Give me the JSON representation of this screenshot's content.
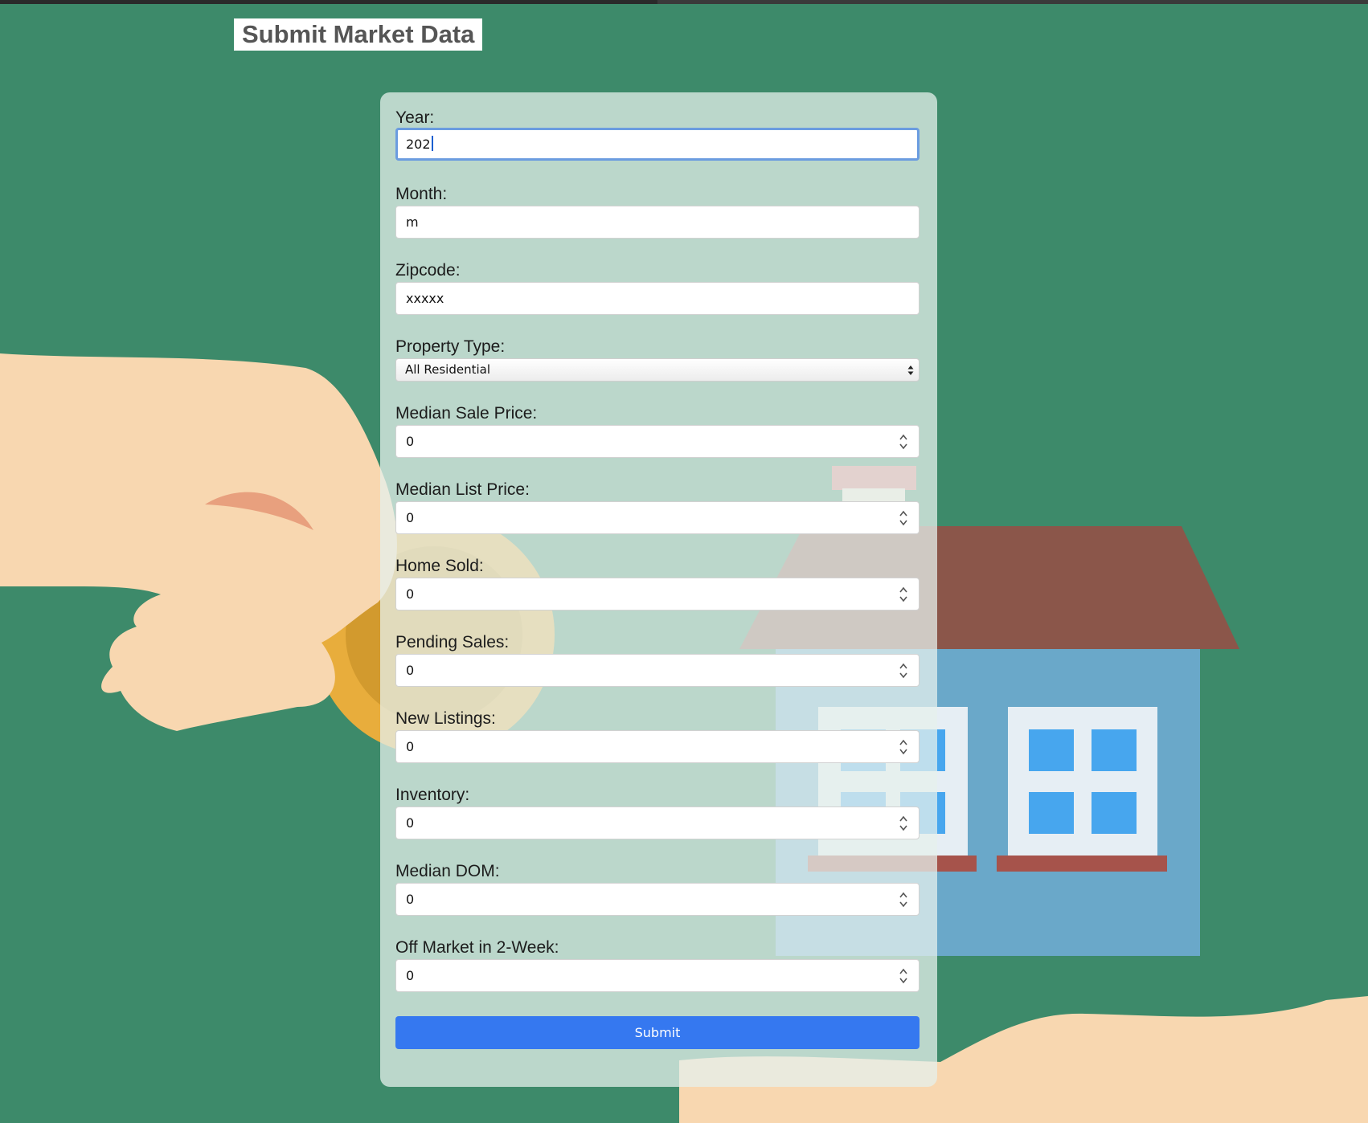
{
  "page": {
    "title": "Submit Market Data"
  },
  "form": {
    "year": {
      "label": "Year:",
      "value": "202"
    },
    "month": {
      "label": "Month:",
      "value": "m"
    },
    "zipcode": {
      "label": "Zipcode:",
      "value": "xxxxx"
    },
    "property_type": {
      "label": "Property Type:",
      "value": "All Residential"
    },
    "median_sale_price": {
      "label": "Median Sale Price:",
      "value": "0"
    },
    "median_list_price": {
      "label": "Median List Price:",
      "value": "0"
    },
    "home_sold": {
      "label": "Home Sold:",
      "value": "0"
    },
    "pending_sales": {
      "label": "Pending Sales:",
      "value": "0"
    },
    "new_listings": {
      "label": "New Listings:",
      "value": "0"
    },
    "inventory": {
      "label": "Inventory:",
      "value": "0"
    },
    "median_dom": {
      "label": "Median DOM:",
      "value": "0"
    },
    "off_market_2week": {
      "label": "Off Market in 2-Week:",
      "value": "0"
    },
    "submit_label": "Submit"
  },
  "colors": {
    "background": "#3d8a6a",
    "submit_button": "#3578f0",
    "focus_ring": "#6b9ce0",
    "title_text": "#555555"
  },
  "icons": {
    "select": "select-arrows-icon",
    "number_stepper": "spinner-arrows-icon"
  }
}
